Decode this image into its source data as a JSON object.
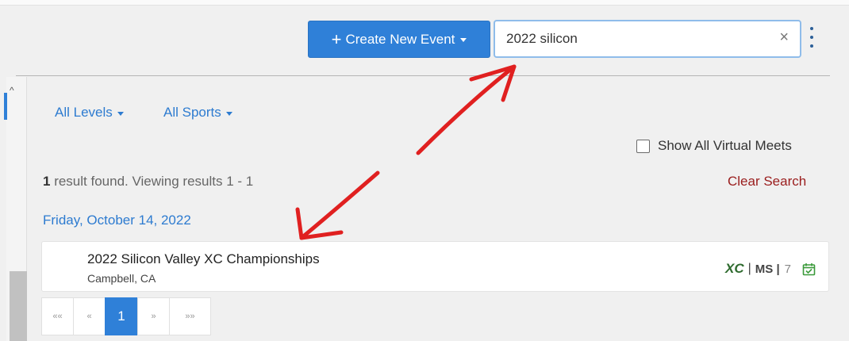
{
  "toolbar": {
    "create_label": "Create New Event",
    "create_plus": "+",
    "search_value": "2022 silicon",
    "clear_symbol": "×"
  },
  "filters": {
    "levels_label": "All Levels",
    "sports_label": "All Sports"
  },
  "virtual_meets": {
    "label": "Show All Virtual Meets",
    "checked": false
  },
  "results": {
    "count": "1",
    "text": " result found. Viewing results 1 - 1",
    "clear_label": "Clear Search"
  },
  "events_group": {
    "date": "Friday, October 14, 2022",
    "events": [
      {
        "name": "2022 Silicon Valley XC Championships",
        "location": "Campbell, CA",
        "sport": "XC",
        "separator": "|",
        "level": "MS |",
        "count": "7"
      }
    ]
  },
  "pagination": {
    "first": "««",
    "prev": "«",
    "current": "1",
    "next": "»",
    "last": "»»"
  },
  "colors": {
    "accent": "#2f80d8",
    "link": "#2d7bd0",
    "danger_link": "#9a1d1d",
    "annotation": "#e02020",
    "success": "#3a9a3a"
  },
  "icons": [
    "chevron-up-icon",
    "caret-down-icon",
    "close-icon",
    "kebab-menu-icon",
    "calendar-check-icon"
  ]
}
